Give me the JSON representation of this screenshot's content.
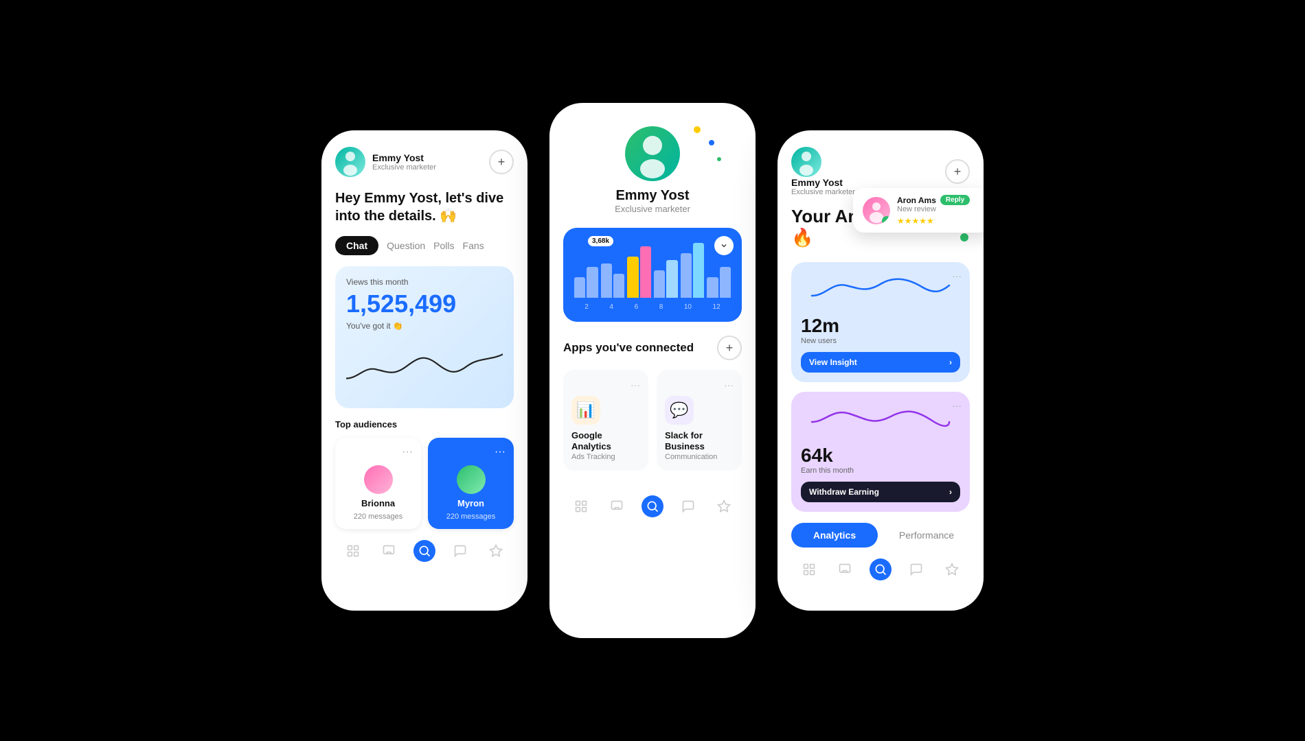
{
  "phone1": {
    "user": {
      "name": "Emmy Yost",
      "title": "Exclusive marketer"
    },
    "greeting": "Hey Emmy Yost, let's dive into the details. 🙌",
    "tabs": [
      "Chat",
      "Question",
      "Polls",
      "Fans"
    ],
    "active_tab": "Chat",
    "stats": {
      "label": "Views this month",
      "number": "1,525,499",
      "sub": "You've got it 👏"
    },
    "top_audiences_label": "Top audiences",
    "audiences": [
      {
        "name": "Brionna",
        "messages": "220 messages",
        "type": "pink"
      },
      {
        "name": "Myron",
        "messages": "220 messages",
        "type": "green"
      }
    ],
    "plus_label": "+"
  },
  "phone2": {
    "user": {
      "name": "Emmy Yost",
      "title": "Exclusive marketer"
    },
    "chart": {
      "tooltip": "3,68k",
      "x_labels": [
        "2",
        "4",
        "6",
        "8",
        "10",
        "12"
      ]
    },
    "apps_section_title": "Apps you've connected",
    "apps": [
      {
        "name": "Google Analytics",
        "sub": "Ads Tracking",
        "icon": "📊"
      },
      {
        "name": "Slack for Business",
        "sub": "Communication",
        "icon": "💬"
      }
    ],
    "plus_label": "+"
  },
  "phone3": {
    "user": {
      "name": "Emmy Yost",
      "title": "Exclusive marketer"
    },
    "heading": "Your Amazing Stats 🔥",
    "notification": {
      "name": "Aron Ams",
      "reply_label": "Reply",
      "sub": "New review",
      "stars": "★★★★★"
    },
    "stats": [
      {
        "number": "12m",
        "label": "New users",
        "btn_label": "View Insight",
        "color": "blue"
      },
      {
        "number": "64k",
        "label": "Earn this month",
        "btn_label": "Withdraw Earning",
        "color": "purple"
      }
    ],
    "bottom_tabs": [
      "Analytics",
      "Performance"
    ],
    "active_tab": "Analytics",
    "plus_label": "+"
  }
}
